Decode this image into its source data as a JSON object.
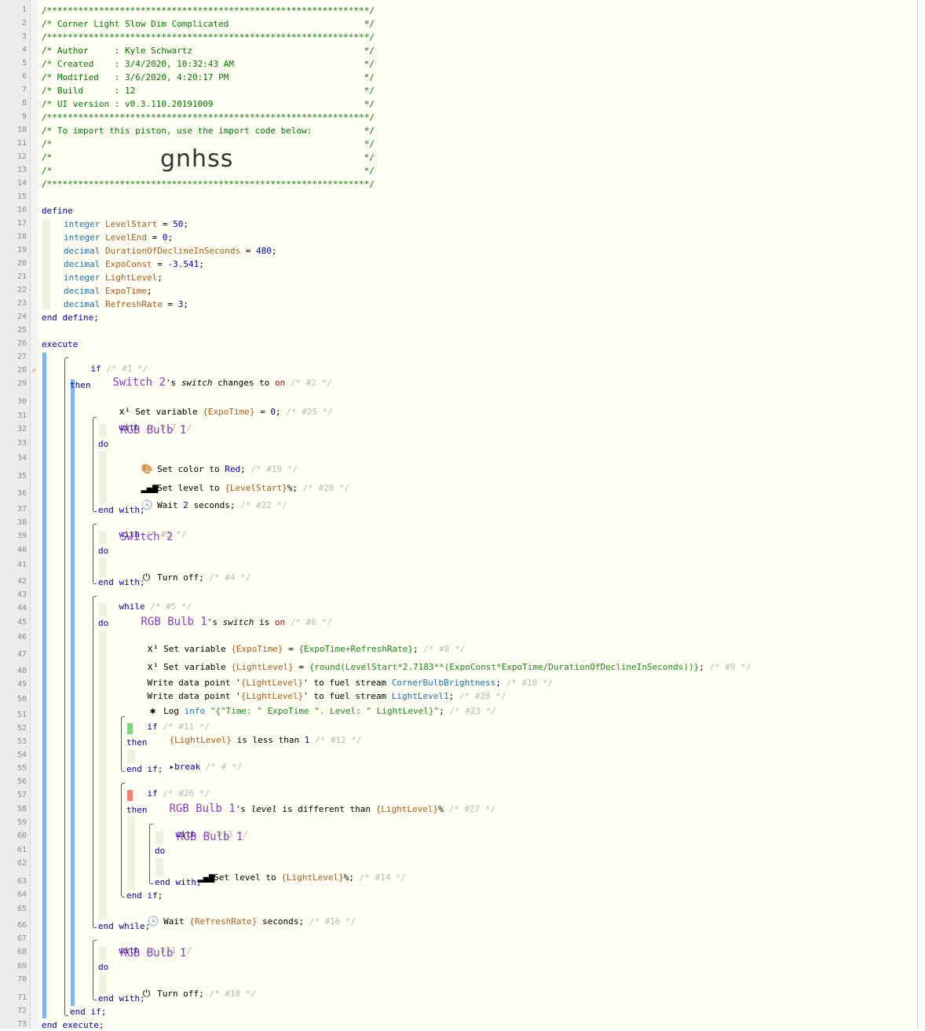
{
  "header_lines": [
    "/**************************************************************/",
    "/* Corner Light Slow Dim Complicated                          */",
    "/**************************************************************/",
    "/* Author     : Kyle Schwartz                                 */",
    "/* Created    : 3/4/2020, 10:32:43 AM                         */",
    "/* Modified   : 3/6/2020, 4:20:17 PM                          */",
    "/* Build      : 12                                            */",
    "/* UI version : v0.3.110.20191009                             */",
    "/**************************************************************/",
    "/* To import this piston, use the import code below:          */",
    "/*                                                            */",
    "/*                                                            */",
    "/*                                                            */",
    "/**************************************************************/"
  ],
  "import_code": "gnhss",
  "kw": {
    "define": "define",
    "end_define": "end define;",
    "execute": "execute",
    "end_execute": "end execute;",
    "if": "if",
    "then": "then",
    "end_if": "end if;",
    "with": "with",
    "do": "do",
    "end_with": "end with;",
    "while": "while",
    "end_while": "end while;",
    "break": "break"
  },
  "variables": [
    {
      "type": "integer",
      "name": "LevelStart",
      "eq": " = ",
      "value": "50",
      "end": ";"
    },
    {
      "type": "integer",
      "name": "LevelEnd",
      "eq": " = ",
      "value": "0",
      "end": ";"
    },
    {
      "type": "decimal",
      "name": "DurationOfDeclineInSeconds",
      "eq": " = ",
      "value": "480",
      "end": ";"
    },
    {
      "type": "decimal",
      "name": "ExpoConst",
      "eq": " = ",
      "value": "-3.541",
      "end": ";"
    },
    {
      "type": "integer",
      "name": "LightLevel",
      "eq": "",
      "value": "",
      "end": ";"
    },
    {
      "type": "decimal",
      "name": "ExpoTime",
      "eq": "",
      "value": "",
      "end": ";"
    },
    {
      "type": "decimal",
      "name": "RefreshRate",
      "eq": " = ",
      "value": "3",
      "end": ";"
    }
  ],
  "tags": {
    "t1": "/* #1 */",
    "t2": "/* #2 */",
    "t25": "/* #25 */",
    "t17": "/* #17 */",
    "t19": "/* #19 */",
    "t20": "/* #20 */",
    "t22": "/* #22 */",
    "t3": "/* #3 */",
    "t4": "/* #4 */",
    "t5": "/* #5 */",
    "t6": "/* #6 */",
    "t8": "/* #8 */",
    "t9": "/* #9 */",
    "t10": "/* #10 */",
    "t28": "/* #28 */",
    "t23": "/* #23 */",
    "t11": "/* #11 */",
    "t12": "/* #12 */",
    "tbrk": "/* # */",
    "t26": "/* #26 */",
    "t27": "/* #27 */",
    "t13": "/* #13 */",
    "t14": "/* #14 */",
    "t16": "/* #16 */",
    "t21": "/* #21 */",
    "t18": "/* #18 */"
  },
  "devices": {
    "switch2": "Switch 2",
    "bulb1": "RGB Bulb 1"
  },
  "text": {
    "s_switch": "'s ",
    "switch_attr": "switch",
    "changes_to": " changes to ",
    "on": "on",
    "set_variable": " Set variable ",
    "expotime_var": "{ExpoTime}",
    "eq0": " = ",
    "zero": "0",
    "semi": "; ",
    "set_color": " Set color to ",
    "red": "Red",
    "set_level": " Set level to ",
    "levelstart_var": "{LevelStart}",
    "pct": "%; ",
    "wait": " Wait ",
    "two": "2",
    "seconds": " seconds; ",
    "turn_off": " Turn off; ",
    "is": " is ",
    "eq_sp": " = ",
    "expo_expr": "{ExpoTime+RefreshRate}",
    "lightlevel_var": "{LightLevel}",
    "round_expr": "{round(LevelStart*2.7183**(ExpoConst*ExpoTime/DurationOfDeclineInSeconds))}",
    "write_dp": "Write data point '",
    "to_fuel": "' to fuel stream ",
    "stream1": "CornerBulbBrightness",
    "stream2": "LightLevel1",
    "log": " Log ",
    "info": "info",
    "log_str": "\"{\"Time: \" ExpoTime \". Level: \" LightLevel}\"",
    "less_than": " is less than ",
    "one": "1",
    "level_attr": "level",
    "different": " is different than ",
    "pct_only": "% ",
    "refresh_var": "{RefreshRate}"
  }
}
